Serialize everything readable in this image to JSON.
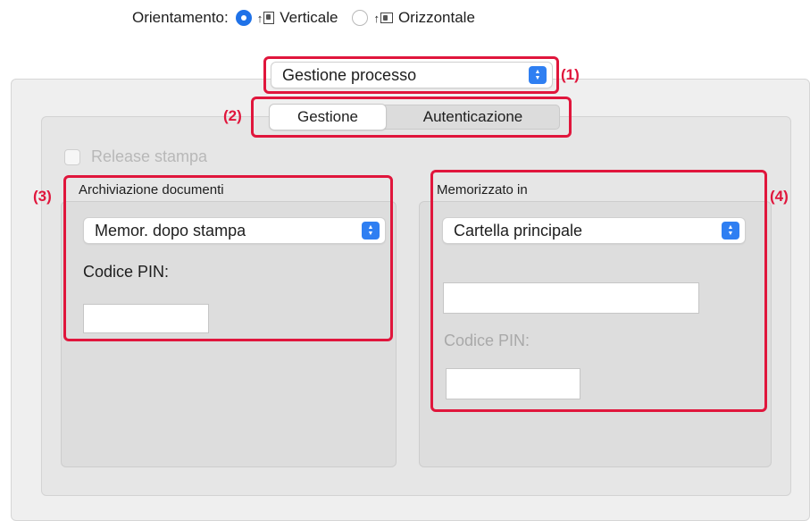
{
  "orientation": {
    "label": "Orientamento:",
    "options": [
      {
        "label": "Verticale",
        "selected": true
      },
      {
        "label": "Orizzontale",
        "selected": false
      }
    ]
  },
  "panel_selector": {
    "value": "Gestione processo"
  },
  "tabs": [
    {
      "label": "Gestione",
      "active": true
    },
    {
      "label": "Autenticazione",
      "active": false
    }
  ],
  "release_print": {
    "label": "Release stampa",
    "checked": false,
    "enabled": false
  },
  "document_filing": {
    "group_title": "Archiviazione documenti",
    "mode_value": "Memor. dopo stampa",
    "pin_label": "Codice PIN:",
    "pin_value": ""
  },
  "stored_in": {
    "group_title": "Memorizzato in",
    "folder_value": "Cartella principale",
    "folder_name_value": "",
    "pin_label": "Codice PIN:",
    "pin_value": ""
  },
  "callouts": {
    "c1": "(1)",
    "c2": "(2)",
    "c3": "(3)",
    "c4": "(4)"
  },
  "colors": {
    "accent": "#1f72e8",
    "callout": "#e0163c"
  }
}
